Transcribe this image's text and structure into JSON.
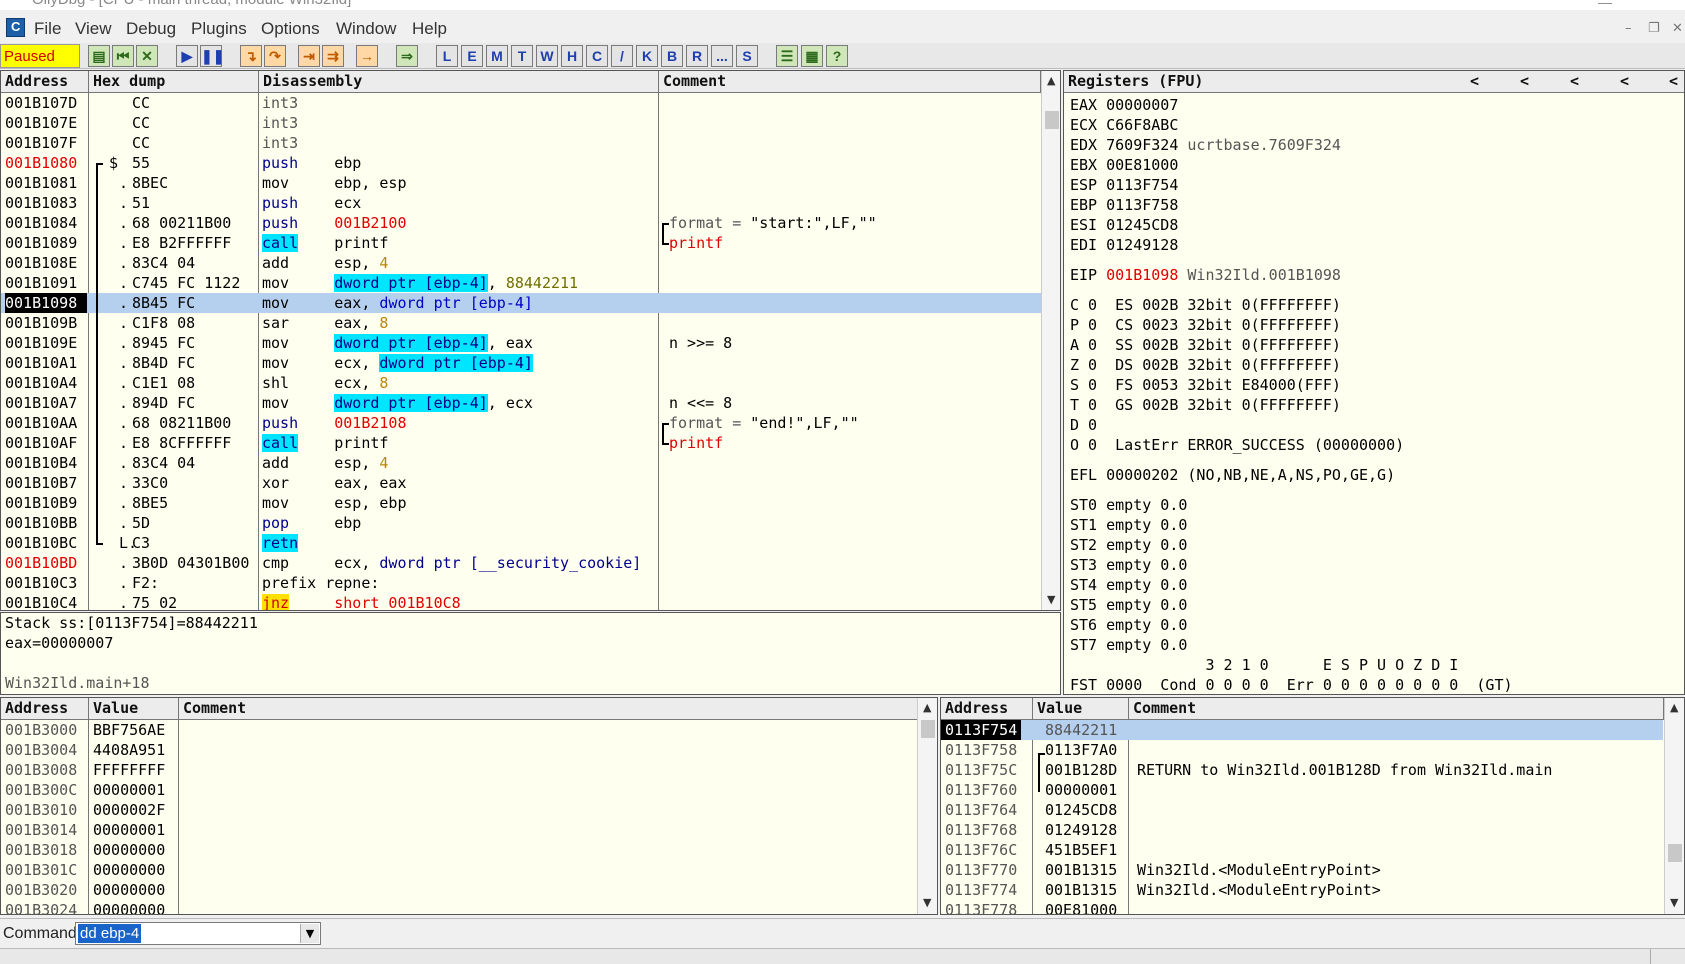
{
  "window": {
    "title": "OllyDbg - [CPU - main thread, module Win32Ild]"
  },
  "menu": [
    "File",
    "View",
    "Debug",
    "Plugins",
    "Options",
    "Window",
    "Help"
  ],
  "toolbar": {
    "status": "Paused",
    "letters": [
      "L",
      "E",
      "M",
      "T",
      "W",
      "H",
      "C",
      "/",
      "K",
      "B",
      "R",
      "...",
      "S"
    ]
  },
  "disasm": {
    "headers": [
      "Address",
      "Hex dump",
      "Disassembly",
      "Comment"
    ],
    "rows": [
      {
        "addr": "001B107D",
        "mark": "",
        "hex": "CC",
        "mn": "int3",
        "ops": [],
        "cm": "",
        "addr_red": false,
        "mn_style": "gray"
      },
      {
        "addr": "001B107E",
        "mark": "",
        "hex": "CC",
        "mn": "int3",
        "ops": [],
        "cm": "",
        "addr_red": false,
        "mn_style": "gray"
      },
      {
        "addr": "001B107F",
        "mark": "",
        "hex": "CC",
        "mn": "int3",
        "ops": [],
        "cm": "",
        "addr_red": false,
        "mn_style": "gray"
      },
      {
        "addr": "001B1080",
        "mark": "$",
        "hex": "55",
        "mn": "push",
        "ops": [
          {
            "t": "ebp",
            "c": ""
          }
        ],
        "cm": "",
        "addr_red": true,
        "mn_style": "navy"
      },
      {
        "addr": "001B1081",
        "mark": ".",
        "hex": "8BEC",
        "mn": "mov",
        "ops": [
          {
            "t": "ebp, esp",
            "c": ""
          }
        ],
        "cm": "",
        "addr_red": false,
        "mn_style": ""
      },
      {
        "addr": "001B1083",
        "mark": ".",
        "hex": "51",
        "mn": "push",
        "ops": [
          {
            "t": "ecx",
            "c": ""
          }
        ],
        "cm": "",
        "addr_red": false,
        "mn_style": "navy"
      },
      {
        "addr": "001B1084",
        "mark": ".",
        "hex": "68 00211B00",
        "mn": "push",
        "ops": [
          {
            "t": "001B2100",
            "c": "red"
          }
        ],
        "cm": "format = \"start:\",LF,\"\"",
        "cm_label": "format",
        "cm_rest": " = ",
        "cm_val": "\"start:\",LF,\"\"",
        "addr_red": false,
        "mn_style": "navy"
      },
      {
        "addr": "001B1089",
        "mark": ".",
        "hex": "E8 B2FFFFFF",
        "mn": "call",
        "ops": [
          {
            "t": "printf",
            "c": ""
          }
        ],
        "cm": "printf",
        "addr_red": false,
        "mn_style": "call"
      },
      {
        "addr": "001B108E",
        "mark": ".",
        "hex": "83C4 04",
        "mn": "add",
        "ops": [
          {
            "t": "esp, ",
            "c": ""
          },
          {
            "t": "4",
            "c": "num"
          }
        ],
        "cm": "",
        "addr_red": false,
        "mn_style": ""
      },
      {
        "addr": "001B1091",
        "mark": ".",
        "hex": "C745 FC 1122",
        "mn": "mov",
        "ops": [
          {
            "t": "dword ptr [ebp-4]",
            "c": "hl"
          },
          {
            "t": ", ",
            "c": ""
          },
          {
            "t": "88442211",
            "c": "olive"
          }
        ],
        "cm": "",
        "addr_red": false,
        "mn_style": ""
      },
      {
        "addr": "001B1098",
        "mark": ".",
        "hex": "8B45 FC",
        "mn": "mov",
        "ops": [
          {
            "t": "eax, ",
            "c": ""
          },
          {
            "t": "dword ptr [ebp-4]",
            "c": "blue"
          }
        ],
        "cm": "",
        "addr_red": false,
        "mn_style": "",
        "sel": true
      },
      {
        "addr": "001B109B",
        "mark": ".",
        "hex": "C1F8 08",
        "mn": "sar",
        "ops": [
          {
            "t": "eax, ",
            "c": ""
          },
          {
            "t": "8",
            "c": "num"
          }
        ],
        "cm": "",
        "addr_red": false,
        "mn_style": ""
      },
      {
        "addr": "001B109E",
        "mark": ".",
        "hex": "8945 FC",
        "mn": "mov",
        "ops": [
          {
            "t": "dword ptr [ebp-4]",
            "c": "hl"
          },
          {
            "t": ", eax",
            "c": ""
          }
        ],
        "cm": "n >>= 8",
        "addr_red": false,
        "mn_style": ""
      },
      {
        "addr": "001B10A1",
        "mark": ".",
        "hex": "8B4D FC",
        "mn": "mov",
        "ops": [
          {
            "t": "ecx, ",
            "c": ""
          },
          {
            "t": "dword ptr [ebp-4]",
            "c": "hl"
          }
        ],
        "cm": "",
        "addr_red": false,
        "mn_style": ""
      },
      {
        "addr": "001B10A4",
        "mark": ".",
        "hex": "C1E1 08",
        "mn": "shl",
        "ops": [
          {
            "t": "ecx, ",
            "c": ""
          },
          {
            "t": "8",
            "c": "num"
          }
        ],
        "cm": "",
        "addr_red": false,
        "mn_style": ""
      },
      {
        "addr": "001B10A7",
        "mark": ".",
        "hex": "894D FC",
        "mn": "mov",
        "ops": [
          {
            "t": "dword ptr [ebp-4]",
            "c": "hl"
          },
          {
            "t": ", ecx",
            "c": ""
          }
        ],
        "cm": "n <<= 8",
        "addr_red": false,
        "mn_style": ""
      },
      {
        "addr": "001B10AA",
        "mark": ".",
        "hex": "68 08211B00",
        "mn": "push",
        "ops": [
          {
            "t": "001B2108",
            "c": "red"
          }
        ],
        "cm": "format = \"end!\",LF,\"\"",
        "cm_label": "format",
        "cm_rest": " = ",
        "cm_val": "\"end!\",LF,\"\"",
        "addr_red": false,
        "mn_style": "navy"
      },
      {
        "addr": "001B10AF",
        "mark": ".",
        "hex": "E8 8CFFFFFF",
        "mn": "call",
        "ops": [
          {
            "t": "printf",
            "c": ""
          }
        ],
        "cm": "printf",
        "addr_red": false,
        "mn_style": "call"
      },
      {
        "addr": "001B10B4",
        "mark": ".",
        "hex": "83C4 04",
        "mn": "add",
        "ops": [
          {
            "t": "esp, ",
            "c": ""
          },
          {
            "t": "4",
            "c": "num"
          }
        ],
        "cm": "",
        "addr_red": false,
        "mn_style": ""
      },
      {
        "addr": "001B10B7",
        "mark": ".",
        "hex": "33C0",
        "mn": "xor",
        "ops": [
          {
            "t": "eax, eax",
            "c": ""
          }
        ],
        "cm": "",
        "addr_red": false,
        "mn_style": ""
      },
      {
        "addr": "001B10B9",
        "mark": ".",
        "hex": "8BE5",
        "mn": "mov",
        "ops": [
          {
            "t": "esp, ebp",
            "c": ""
          }
        ],
        "cm": "",
        "addr_red": false,
        "mn_style": ""
      },
      {
        "addr": "001B10BB",
        "mark": ".",
        "hex": "5D",
        "mn": "pop",
        "ops": [
          {
            "t": "ebp",
            "c": ""
          }
        ],
        "cm": "",
        "addr_red": false,
        "mn_style": "navy"
      },
      {
        "addr": "001B10BC",
        "mark": "L.",
        "hex": "C3",
        "mn": "retn",
        "ops": [],
        "cm": "",
        "addr_red": false,
        "mn_style": "retn"
      },
      {
        "addr": "001B10BD",
        "mark": ".",
        "hex": "3B0D 04301B00",
        "mn": "cmp",
        "ops": [
          {
            "t": "ecx, ",
            "c": ""
          },
          {
            "t": "dword ptr [__security_cookie]",
            "c": "navy"
          }
        ],
        "cm": "",
        "addr_red": true,
        "mn_style": ""
      },
      {
        "addr": "001B10C3",
        "mark": ".",
        "hex": "F2:",
        "mn": "prefix repne:",
        "ops": [],
        "cm": "",
        "addr_red": false,
        "mn_style": ""
      },
      {
        "addr": "001B10C4",
        "mark": ".",
        "hex": "75 02",
        "mn": "jnz",
        "ops": [
          {
            "t": "short 001B10C8",
            "c": "red"
          }
        ],
        "cm": "",
        "addr_red": false,
        "mn_style": "jnz"
      }
    ]
  },
  "info": {
    "line1": "Stack ss:[0113F754]=88442211",
    "line2": "eax=00000007",
    "line3": "",
    "line4": "Win32Ild.main+18"
  },
  "registers": {
    "title": "Registers (FPU)",
    "gp": [
      {
        "n": "EAX",
        "v": "00000007",
        "x": ""
      },
      {
        "n": "ECX",
        "v": "C66F8ABC",
        "x": ""
      },
      {
        "n": "EDX",
        "v": "7609F324",
        "x": "ucrtbase.7609F324"
      },
      {
        "n": "EBX",
        "v": "00E81000",
        "x": ""
      },
      {
        "n": "ESP",
        "v": "0113F754",
        "x": ""
      },
      {
        "n": "EBP",
        "v": "0113F758",
        "x": ""
      },
      {
        "n": "ESI",
        "v": "01245CD8",
        "x": ""
      },
      {
        "n": "EDI",
        "v": "01249128",
        "x": ""
      }
    ],
    "eip": {
      "n": "EIP",
      "v": "001B1098",
      "x": "Win32Ild.001B1098"
    },
    "flags": [
      "C 0  ES 002B 32bit 0(FFFFFFFF)",
      "P 0  CS 0023 32bit 0(FFFFFFFF)",
      "A 0  SS 002B 32bit 0(FFFFFFFF)",
      "Z 0  DS 002B 32bit 0(FFFFFFFF)",
      "S 0  FS 0053 32bit E84000(FFF)",
      "T 0  GS 002B 32bit 0(FFFFFFFF)",
      "D 0",
      "O 0  LastErr ERROR_SUCCESS (00000000)"
    ],
    "efl": "EFL 00000202 (NO,NB,NE,A,NS,PO,GE,G)",
    "fpu": [
      "ST0 empty 0.0",
      "ST1 empty 0.0",
      "ST2 empty 0.0",
      "ST3 empty 0.0",
      "ST4 empty 0.0",
      "ST5 empty 0.0",
      "ST6 empty 0.0",
      "ST7 empty 0.0"
    ],
    "fst_head": "               3 2 1 0      E S P U O Z D I",
    "fst": "FST 0000  Cond 0 0 0 0  Err 0 0 0 0 0 0 0 0  (GT)"
  },
  "dump": {
    "headers": [
      "Address",
      "Value",
      "Comment"
    ],
    "rows": [
      {
        "a": "001B3000",
        "v": "BBF756AE"
      },
      {
        "a": "001B3004",
        "v": "4408A951"
      },
      {
        "a": "001B3008",
        "v": "FFFFFFFF"
      },
      {
        "a": "001B300C",
        "v": "00000001"
      },
      {
        "a": "001B3010",
        "v": "0000002F"
      },
      {
        "a": "001B3014",
        "v": "00000001"
      },
      {
        "a": "001B3018",
        "v": "00000000"
      },
      {
        "a": "001B301C",
        "v": "00000000"
      },
      {
        "a": "001B3020",
        "v": "00000000"
      },
      {
        "a": "001B3024",
        "v": "00000000"
      }
    ]
  },
  "stack": {
    "headers": [
      "Address",
      "Value",
      "Comment"
    ],
    "rows": [
      {
        "a": "0113F754",
        "v": "88442211",
        "c": "",
        "sel": true
      },
      {
        "a": "0113F758",
        "v": "0113F7A0",
        "c": ""
      },
      {
        "a": "0113F75C",
        "v": "001B128D",
        "c": "RETURN to Win32Ild.001B128D from Win32Ild.main"
      },
      {
        "a": "0113F760",
        "v": "00000001",
        "c": ""
      },
      {
        "a": "0113F764",
        "v": "01245CD8",
        "c": ""
      },
      {
        "a": "0113F768",
        "v": "01249128",
        "c": ""
      },
      {
        "a": "0113F76C",
        "v": "451B5EF1",
        "c": ""
      },
      {
        "a": "0113F770",
        "v": "001B1315",
        "c": "Win32Ild.<ModuleEntryPoint>"
      },
      {
        "a": "0113F774",
        "v": "001B1315",
        "c": "Win32Ild.<ModuleEntryPoint>"
      },
      {
        "a": "0113F778",
        "v": "00E81000",
        "c": ""
      }
    ]
  },
  "command": {
    "label": "Command",
    "value": "dd ebp-4"
  }
}
